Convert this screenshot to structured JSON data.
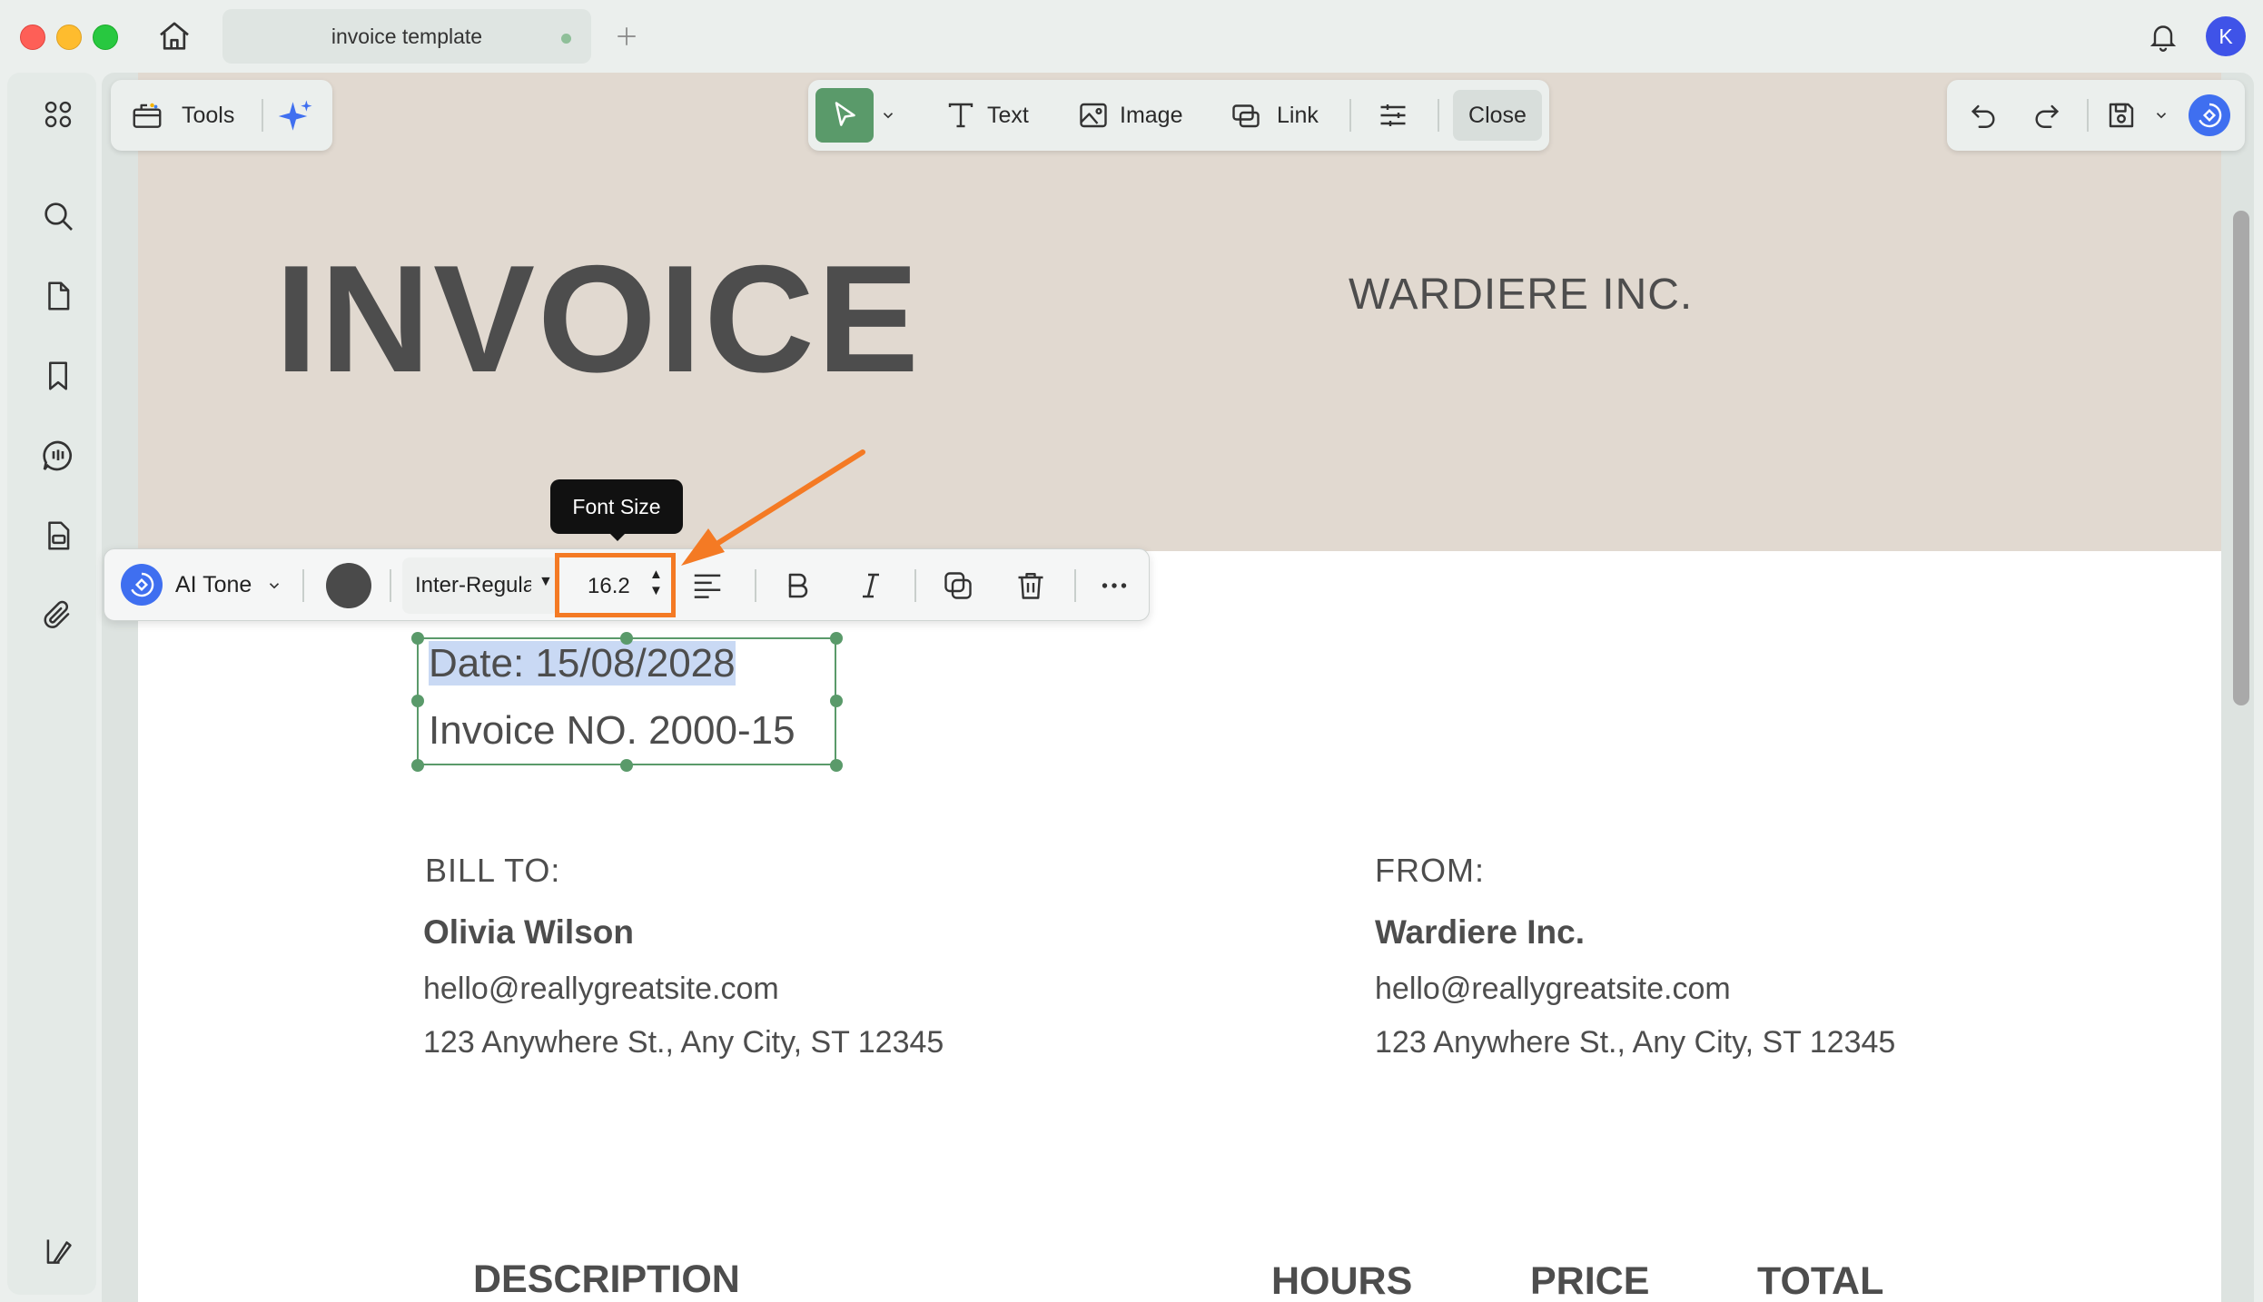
{
  "window": {
    "tab_title": "invoice template",
    "avatar_initial": "K"
  },
  "toolbar_left": {
    "tools_label": "Tools"
  },
  "toolbar_center": {
    "text_label": "Text",
    "image_label": "Image",
    "link_label": "Link",
    "close_label": "Close"
  },
  "format_bar": {
    "ai_tone_label": "AI Tone",
    "font_family": "Inter-Regular",
    "font_size": "16.2",
    "tooltip": "Font Size",
    "text_color": "#4a4a4a"
  },
  "invoice": {
    "title": "INVOICE",
    "company": "WARDIERE INC.",
    "date_line": "Date: 15/08/2028",
    "invoice_no": "Invoice NO. 2000-15",
    "bill_to": {
      "heading": "BILL TO:",
      "name": "Olivia  Wilson",
      "email": "hello@reallygreatsite.com",
      "address": "123 Anywhere St., Any City, ST 12345"
    },
    "from": {
      "heading": "FROM:",
      "name": "Wardiere Inc.",
      "email": "hello@reallygreatsite.com",
      "address": "123 Anywhere St., Any City, ST 12345"
    },
    "table_headers": [
      "DESCRIPTION",
      "HOURS",
      "PRICE",
      "TOTAL"
    ]
  },
  "colors": {
    "accent_green": "#5a9a6a",
    "annotation_orange": "#f47a24",
    "header_band": "#e1d9d0"
  },
  "icons": {
    "rail": [
      "grid-icon",
      "search-icon",
      "page-icon",
      "bookmark-icon",
      "comment-icon",
      "form-icon",
      "attachment-icon",
      "sidebar-toggle-icon"
    ]
  }
}
